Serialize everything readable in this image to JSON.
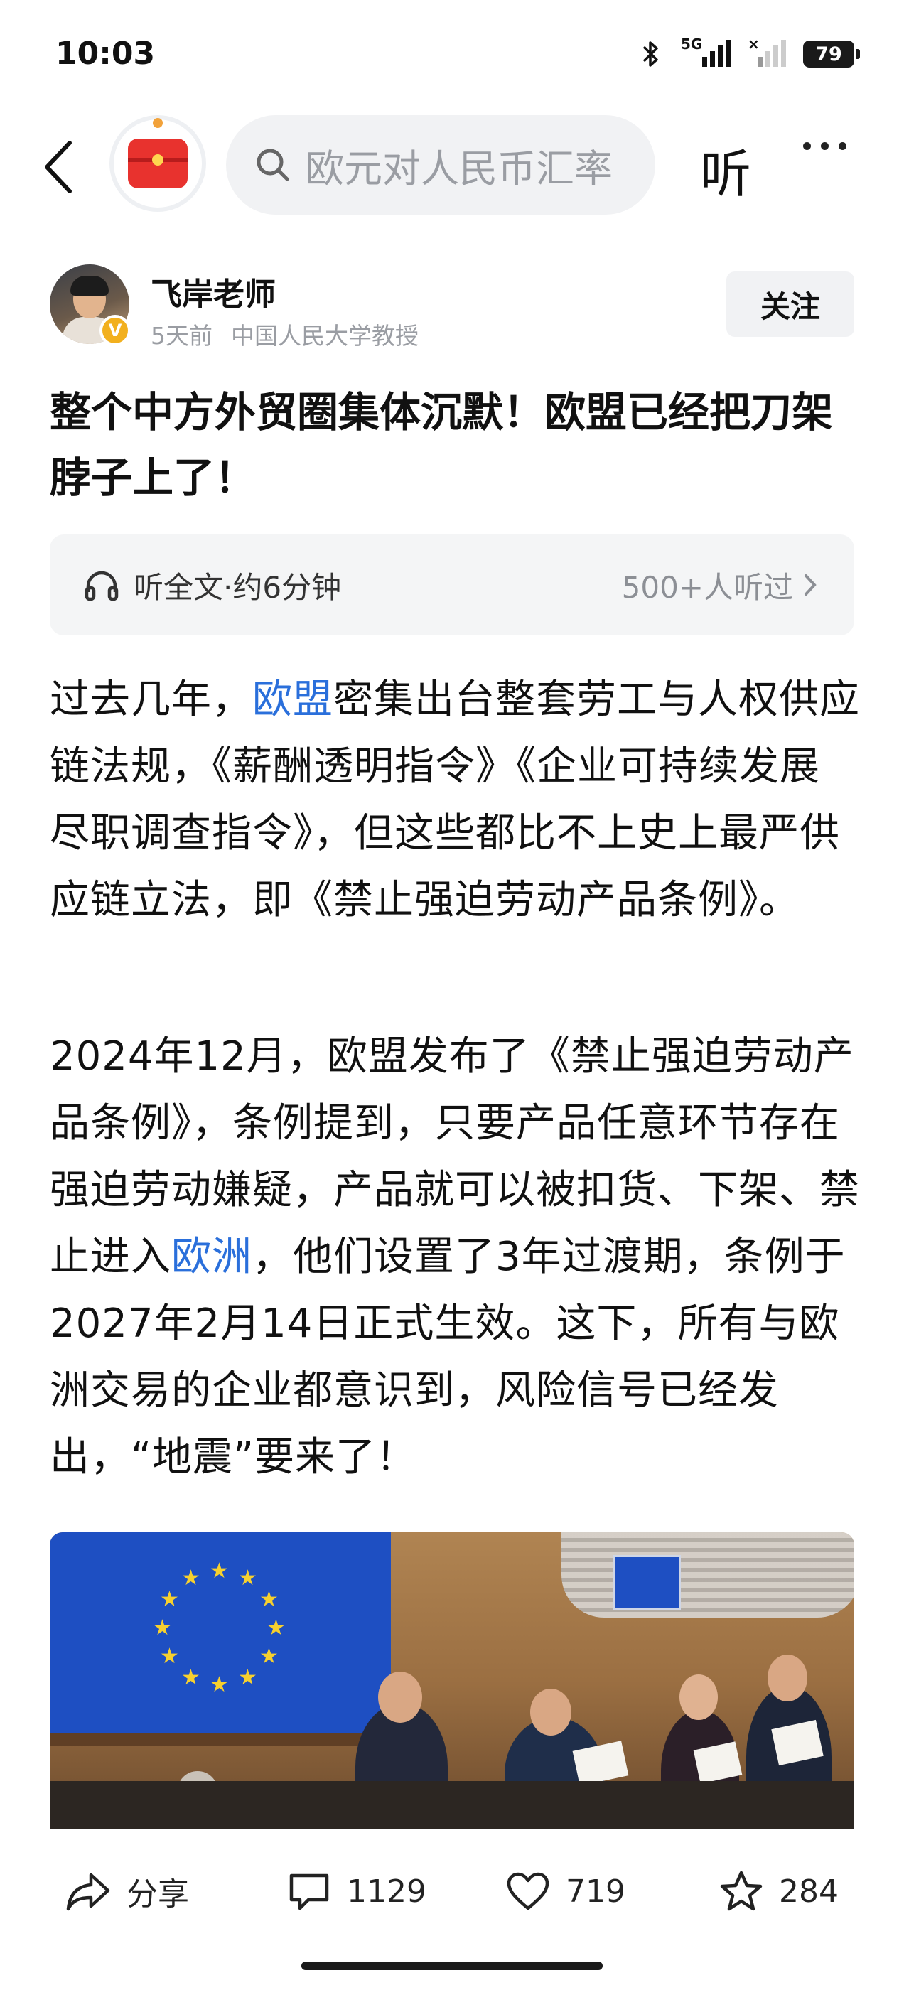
{
  "status_bar": {
    "time": "10:03",
    "signal_label": "5G",
    "battery": "79"
  },
  "nav": {
    "search_placeholder": "欧元对人民币汇率",
    "listen_label": "听"
  },
  "author": {
    "name": "飞岸老师",
    "time_ago": "5天前",
    "description": "中国人民大学教授",
    "verified_mark": "V",
    "follow_label": "关注"
  },
  "article": {
    "title": "整个中方外贸圈集体沉默！欧盟已经把刀架脖子上了！",
    "listen_bar": {
      "left_label": "听全文·约6分钟",
      "right_label": "500+人听过"
    },
    "paragraph1": {
      "t1": "过去几年，",
      "link1": "欧盟",
      "t2": "密集出台整套劳工与人权供应链法规，《薪酬透明指令》《企业可持续发展尽职调查指令》，但这些都比不上史上最严供应链立法，即《禁止强迫劳动产品条例》。"
    },
    "paragraph2": {
      "t1": "2024年12月，欧盟发布了《禁止强迫劳动产品条例》，条例提到，只要产品任意环节存在强迫劳动嫌疑，产品就可以被扣货、下架、禁止进入",
      "link1": "欧洲",
      "t2": "，他们设置了3年过渡期，条例于2027年2月14日正式生效。这下，所有与欧洲交易的企业都意识到，风险信号已经发出，“地震”要来了！"
    }
  },
  "actions": {
    "share_label": "分享",
    "comment_count": "1129",
    "like_count": "719",
    "favorite_count": "284"
  },
  "colors": {
    "link": "#2a6fdb",
    "logo_red": "#e8322e",
    "verified_gold": "#f2b01e"
  },
  "icons": [
    "back-icon",
    "search-icon",
    "more-icon",
    "headphones-icon",
    "chevron-right-icon",
    "share-icon",
    "comment-icon",
    "like-icon",
    "favorite-icon",
    "bluetooth-icon",
    "signal-icon",
    "battery-icon"
  ]
}
